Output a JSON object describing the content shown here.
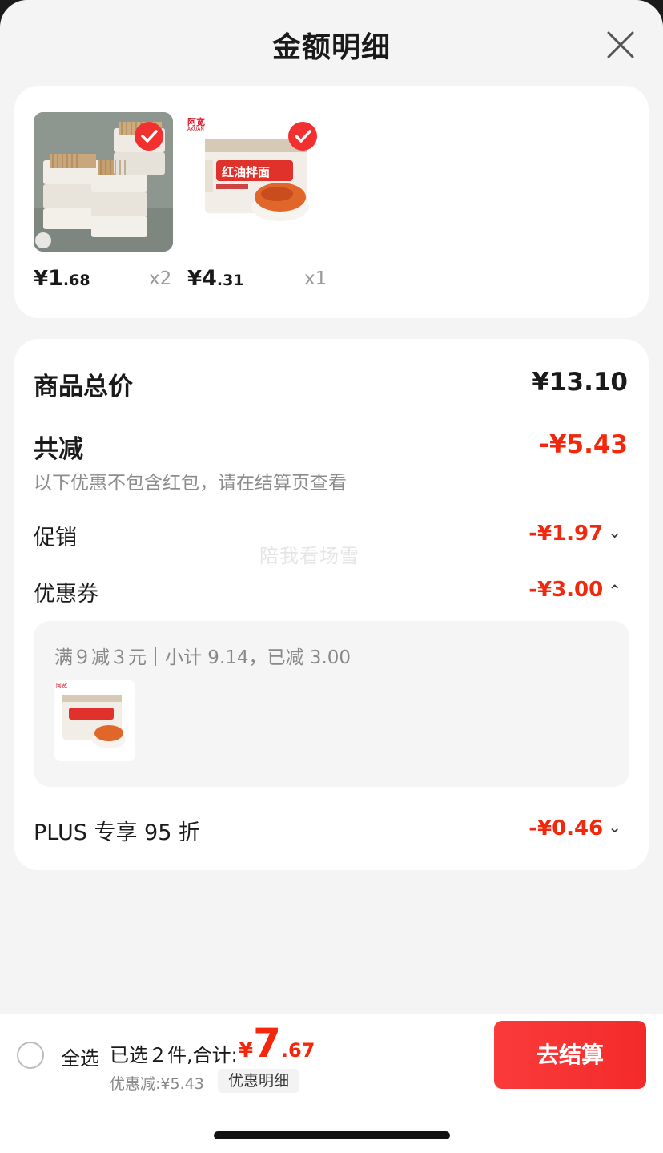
{
  "header": {
    "title": "金额明细",
    "close_icon": "close-icon"
  },
  "products": [
    {
      "name": "cotton-swabs",
      "currency": "¥",
      "price_int": "1",
      "price_dec": ".68",
      "qty": "x2",
      "checked": true
    },
    {
      "name": "red-oil-noodles",
      "currency": "¥",
      "price_int": "4",
      "price_dec": ".31",
      "qty": "x1",
      "checked": true,
      "brand": "阿宽",
      "brand_sub": "AKUAN",
      "pack_text": "红油拌面"
    }
  ],
  "summary": {
    "goods_total_label": "商品总价",
    "goods_total_value": "¥13.10",
    "reduction_label": "共减",
    "reduction_value": "-¥5.43",
    "reduction_note": "以下优惠不包含红包，请在结算页查看",
    "promo_label": "促销",
    "promo_value": "-¥1.97",
    "coupon_label": "优惠券",
    "coupon_value": "-¥3.00",
    "coupon_detail": "满９减３元｜小计 9.14，已减 3.00",
    "plus_label": "PLUS 专享 95 折",
    "plus_value": "-¥0.46"
  },
  "watermark": "陪我看场雪",
  "bottom_bar": {
    "select_all_label": "全选",
    "selected_label": "已选２件,合计:",
    "total_currency": "¥",
    "total_int": "7",
    "total_dec": ".67",
    "discount_label": "优惠减:¥5.43",
    "detail_tag": "优惠明细",
    "checkout_label": "去结算"
  },
  "colors": {
    "accent": "#f2270c",
    "checkout": "#f42a2a",
    "background": "#f4f4f4"
  }
}
